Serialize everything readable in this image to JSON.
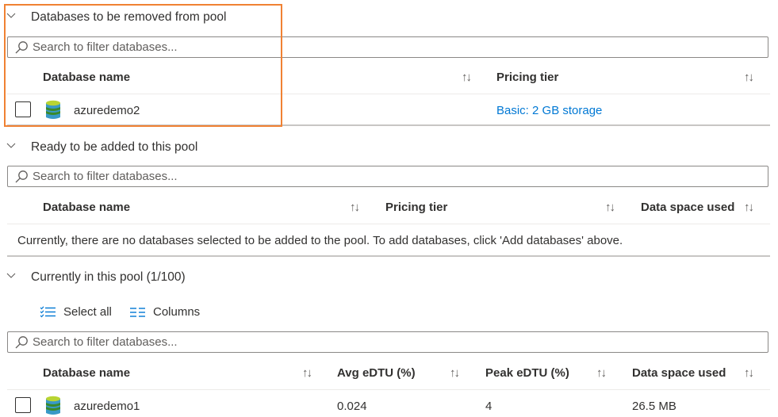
{
  "sections": [
    {
      "title": "Databases to be removed from pool",
      "search_placeholder": "Search to filter databases...",
      "columns": [
        "Database name",
        "Pricing tier"
      ],
      "rows": [
        {
          "name": "azuredemo2",
          "pricing_tier": "Basic: 2 GB storage"
        }
      ]
    },
    {
      "title": "Ready to be added to this pool",
      "search_placeholder": "Search to filter databases...",
      "columns": [
        "Database name",
        "Pricing tier",
        "Data space used"
      ],
      "empty_message": "Currently, there are no databases selected to be added to the pool. To add databases, click 'Add databases' above."
    },
    {
      "title": "Currently in this pool (1/100)",
      "toolbar": {
        "select_all": "Select all",
        "columns": "Columns"
      },
      "search_placeholder": "Search to filter databases...",
      "columns": [
        "Database name",
        "Avg eDTU (%)",
        "Peak eDTU (%)",
        "Data space used"
      ],
      "rows": [
        {
          "name": "azuredemo1",
          "avg_edtu": "0.024",
          "peak_edtu": "4",
          "data_space_used": "26.5 MB"
        }
      ]
    }
  ],
  "sort_glyph": "↑↓",
  "colors": {
    "accent": "#0078d4",
    "highlight": "#f08133",
    "db_icon_green": "#7fba00",
    "db_icon_blue": "#0072c6"
  }
}
